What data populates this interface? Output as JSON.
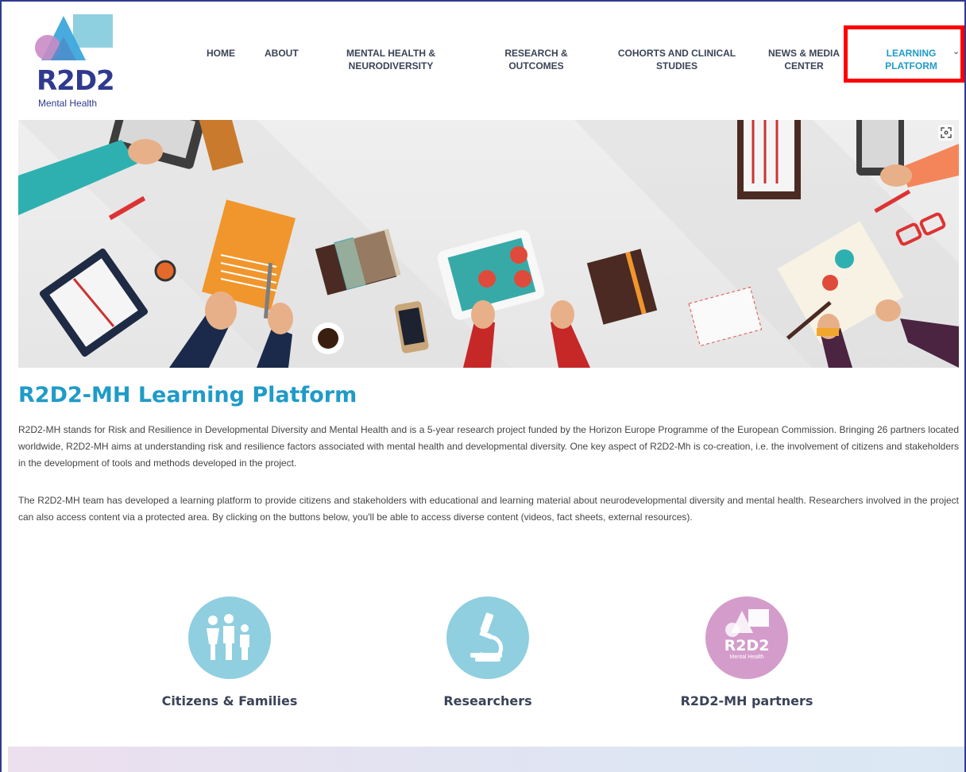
{
  "logo": {
    "name": "R2D2",
    "subtitle": "Mental Health"
  },
  "nav": [
    {
      "label": "HOME"
    },
    {
      "label": "ABOUT"
    },
    {
      "line1": "MENTAL HEALTH &",
      "line2": "NEURODIVERSITY"
    },
    {
      "line1": "RESEARCH &",
      "line2": "OUTCOMES"
    },
    {
      "line1": "COHORTS AND CLINICAL",
      "line2": "STUDIES"
    },
    {
      "line1": "NEWS & MEDIA",
      "line2": "CENTER"
    },
    {
      "line1": "LEARNING",
      "line2": "PLATFORM",
      "active": true
    }
  ],
  "hero": {
    "icon": "expand-icon"
  },
  "main": {
    "title": "R2D2-MH Learning Platform",
    "paragraph1": "R2D2-MH stands for Risk and Resilience in Developmental Diversity and Mental Health and is a 5-year research project funded by the Horizon Europe Programme of the European Commission. Bringing 26 partners located worldwide, R2D2-MH aims at understanding risk and resilience factors associated with mental health and developmental diversity. One key aspect of R2D2-Mh is co-creation, i.e. the involvement of citizens and stakeholders in the development of tools and methods developed in the project.",
    "paragraph2": "The R2D2-MH team has developed a learning platform to provide citizens and stakeholders with educational and learning material about neurodevelopmental diversity and mental health. Researchers involved in the project can also access content via a protected area. By clicking on the buttons below, you'll be able to access diverse content (videos, fact sheets, external resources)."
  },
  "categories": [
    {
      "label": "Citizens & Families",
      "icon": "family-icon",
      "color": "#8fcfdf"
    },
    {
      "label": "Researchers",
      "icon": "microscope-icon",
      "color": "#8fcfdf"
    },
    {
      "label": "R2D2-MH partners",
      "icon": "r2d2-logo-icon",
      "color": "#d49ccb",
      "logo_text": "R2D2",
      "logo_sub": "Mental Health"
    }
  ],
  "colors": {
    "brand_blue": "#2f3a8f",
    "accent_cyan": "#1f9bc8",
    "highlight": "#ff0000"
  }
}
